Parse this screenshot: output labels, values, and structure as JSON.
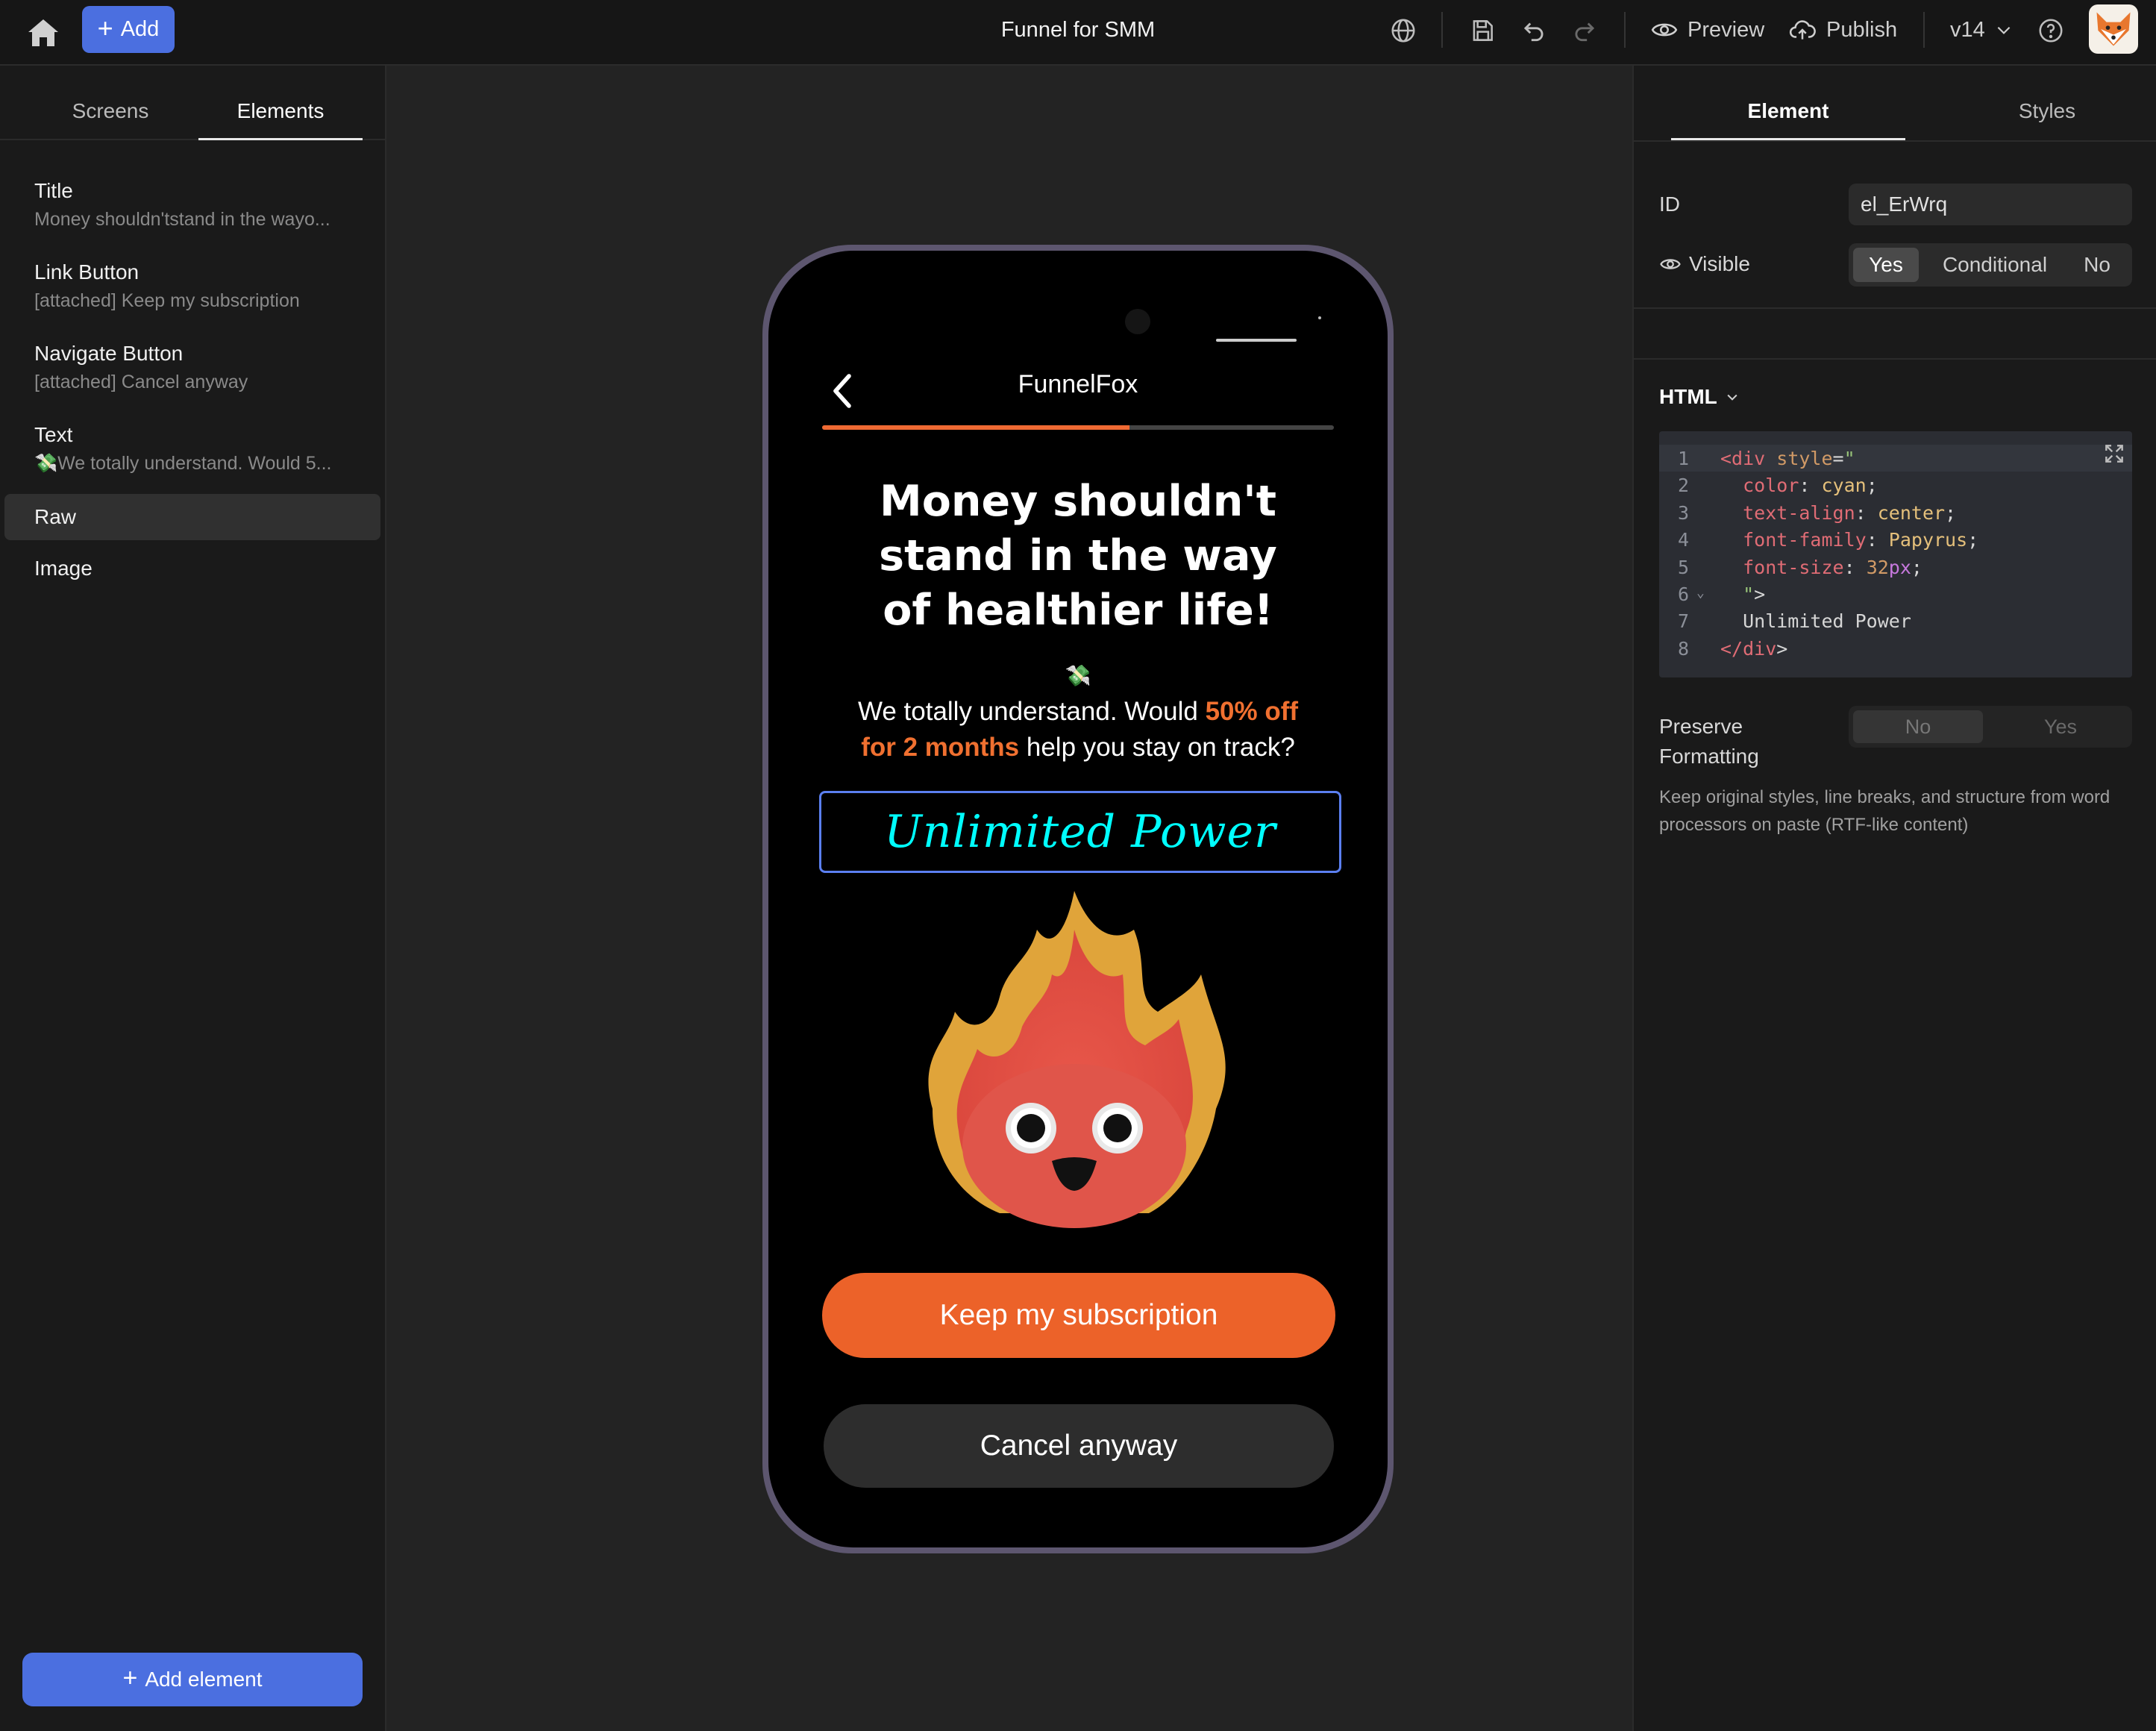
{
  "topbar": {
    "add_label": "Add",
    "title": "Funnel for SMM",
    "preview_label": "Preview",
    "publish_label": "Publish",
    "version": "v14"
  },
  "left": {
    "tabs": [
      "Screens",
      "Elements"
    ],
    "active_tab": "Elements",
    "items": [
      {
        "title": "Title",
        "subtitle": "Money shouldn'tstand in the wayo..."
      },
      {
        "title": "Link Button",
        "subtitle": "[attached] Keep my subscription"
      },
      {
        "title": "Navigate Button",
        "subtitle": "[attached] Cancel anyway"
      },
      {
        "title": "Text",
        "subtitle": "💸We totally understand. Would 5..."
      },
      {
        "title": "Raw",
        "subtitle": ""
      },
      {
        "title": "Image",
        "subtitle": ""
      }
    ],
    "selected_item": "Raw",
    "add_element_label": "Add element"
  },
  "phone": {
    "app_title": "FunnelFox",
    "progress": 0.6,
    "headline": [
      "Money shouldn't",
      "stand in the way",
      "of healthier life!"
    ],
    "emoji": "💸",
    "subtext_pre": "We totally understand. Would ",
    "subtext_hl1": "50% off",
    "subtext_hl2": "for 2 months",
    "subtext_post": " help you stay on track?",
    "raw_text": "Unlimited Power",
    "primary_button": "Keep my subscription",
    "secondary_button": "Cancel anyway"
  },
  "right": {
    "tabs": [
      "Element",
      "Styles"
    ],
    "active_tab": "Element",
    "id_label": "ID",
    "id_value": "el_ErWrq",
    "visible_label": "Visible",
    "visible_options": [
      "Yes",
      "Conditional",
      "No"
    ],
    "visible_selected": "Yes",
    "html_label": "HTML",
    "code_lines": [
      "<div style=\"",
      "  color: cyan;",
      "  text-align: center;",
      "  font-family: Papyrus;",
      "  font-size: 32px;",
      "  \">",
      "  Unlimited Power",
      "</div>"
    ],
    "preserve_label": "Preserve Formatting",
    "preserve_options": [
      "No",
      "Yes"
    ],
    "preserve_selected": "No",
    "help_text": "Keep original styles, line breaks, and structure from word processors on paste (RTF-like content)"
  },
  "colors": {
    "accent": "#4b6fe0",
    "orange": "#ec6229",
    "raw_text": "cyan"
  }
}
